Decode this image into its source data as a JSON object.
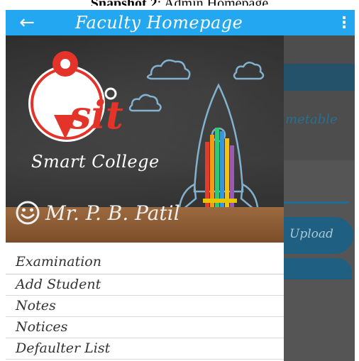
{
  "caption": {
    "label": "Snapshot 2",
    "rest": ": Admin Homepage"
  },
  "appbar": {
    "title": "Faculty Homepage",
    "back_icon": "←",
    "more_icon": "⋮",
    "color": "#23a7f0"
  },
  "background": {
    "timetable": "metable",
    "upload": "Upload"
  },
  "drawer": {
    "logo_text": "sit",
    "college": "Smart College",
    "user_name": "Mr. P. B. Patil",
    "menu": [
      {
        "label": "Examination"
      },
      {
        "label": "Add Student"
      },
      {
        "label": "Notes"
      },
      {
        "label": "Notices"
      },
      {
        "label": "Defaulter List"
      }
    ]
  }
}
